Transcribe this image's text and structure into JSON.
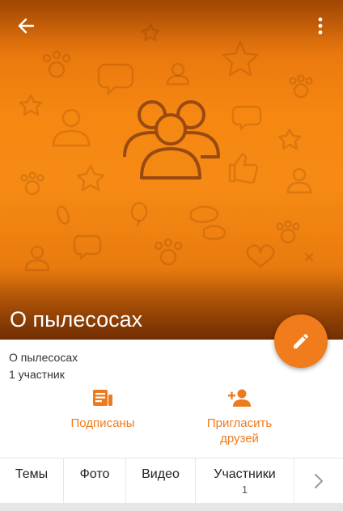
{
  "group": {
    "title": "О пылесосах",
    "name": "О пылесосах",
    "members_text": "1 участник"
  },
  "actions": {
    "subscribed_label": "Подписаны",
    "invite_line1": "Пригласить",
    "invite_line2": "друзей"
  },
  "tabs": [
    {
      "label": "Темы"
    },
    {
      "label": "Фото"
    },
    {
      "label": "Видео"
    },
    {
      "label": "Участники",
      "count": "1"
    }
  ],
  "icons": {
    "back": "arrow-left-icon",
    "more": "more-vertical-icon",
    "group": "group-people-icon",
    "edit": "pencil-icon",
    "subscribed": "newspaper-icon",
    "invite": "add-person-icon",
    "next": "chevron-right-icon"
  },
  "colors": {
    "accent": "#ec7b1e",
    "cover_orange": "#f68812"
  }
}
